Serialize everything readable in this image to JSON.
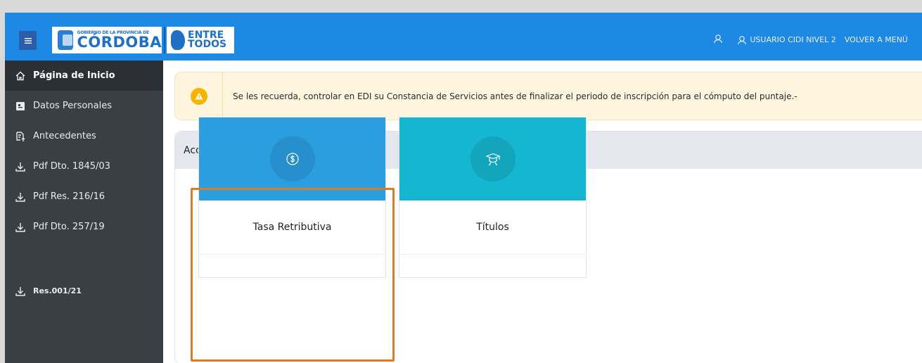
{
  "header": {
    "logo_cordoba_small": "GOBIERNO DE LA PROVINCIA DE",
    "logo_cordoba_big": "CÓRDOBA",
    "logo_entre_line1": "ENTRE",
    "logo_entre_line2": "TODOS",
    "user_label": "USUARIO CIDI NIVEL 2",
    "back_label": "VOLVER A MENÚ"
  },
  "sidebar": {
    "items": [
      {
        "label": "Página de Inicio",
        "icon": "home-icon"
      },
      {
        "label": "Datos Personales",
        "icon": "id-card-icon"
      },
      {
        "label": "Antecedentes",
        "icon": "document-upload-icon"
      },
      {
        "label": "Pdf Dto. 1845/03",
        "icon": "download-icon"
      },
      {
        "label": "Pdf Res. 216/16",
        "icon": "download-icon"
      },
      {
        "label": "Pdf Dto. 257/19",
        "icon": "download-icon"
      },
      {
        "label": "Res.001/21",
        "icon": "download-icon"
      }
    ]
  },
  "alert": {
    "text": "Se les recuerda, controlar en EDI su Constancia de Servicios antes de finalizar el periodo de inscripción para el cómputo del puntaje.-",
    "color": "#f5b400"
  },
  "accesos": {
    "title": "Accesos Directos",
    "tiles": [
      {
        "label": "Tasa Retributiva",
        "icon": "dollar-icon",
        "color": "#2b9ee0"
      },
      {
        "label": "Títulos",
        "icon": "graduation-icon",
        "color": "#15b6cf"
      }
    ]
  },
  "colors": {
    "topbar": "#1e88e5",
    "sidebar": "#3a3f44",
    "highlight": "#e07a1f"
  }
}
